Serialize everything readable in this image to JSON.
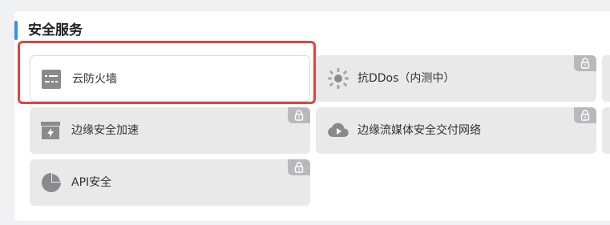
{
  "section": {
    "title": "安全服务"
  },
  "cards": [
    {
      "label": "云防火墙",
      "icon": "firewall-icon",
      "locked": false,
      "active": true
    },
    {
      "label": "抗DDos（内测中）",
      "icon": "ddos-shield-icon",
      "locked": true,
      "active": false
    },
    {
      "label": "边缘安全加速",
      "icon": "edge-acceleration-icon",
      "locked": true,
      "active": false
    },
    {
      "label": "边缘流媒体安全交付网络",
      "icon": "cloud-play-icon",
      "locked": true,
      "active": false
    },
    {
      "label": "API安全",
      "icon": "pie-chart-icon",
      "locked": true,
      "active": false
    }
  ],
  "colors": {
    "accent": "#3b8cf5",
    "highlight": "#e5413e",
    "card_bg": "#e9e9ea",
    "lock_badge": "#b9b9bd",
    "icon_gray": "#8a8a8e"
  }
}
